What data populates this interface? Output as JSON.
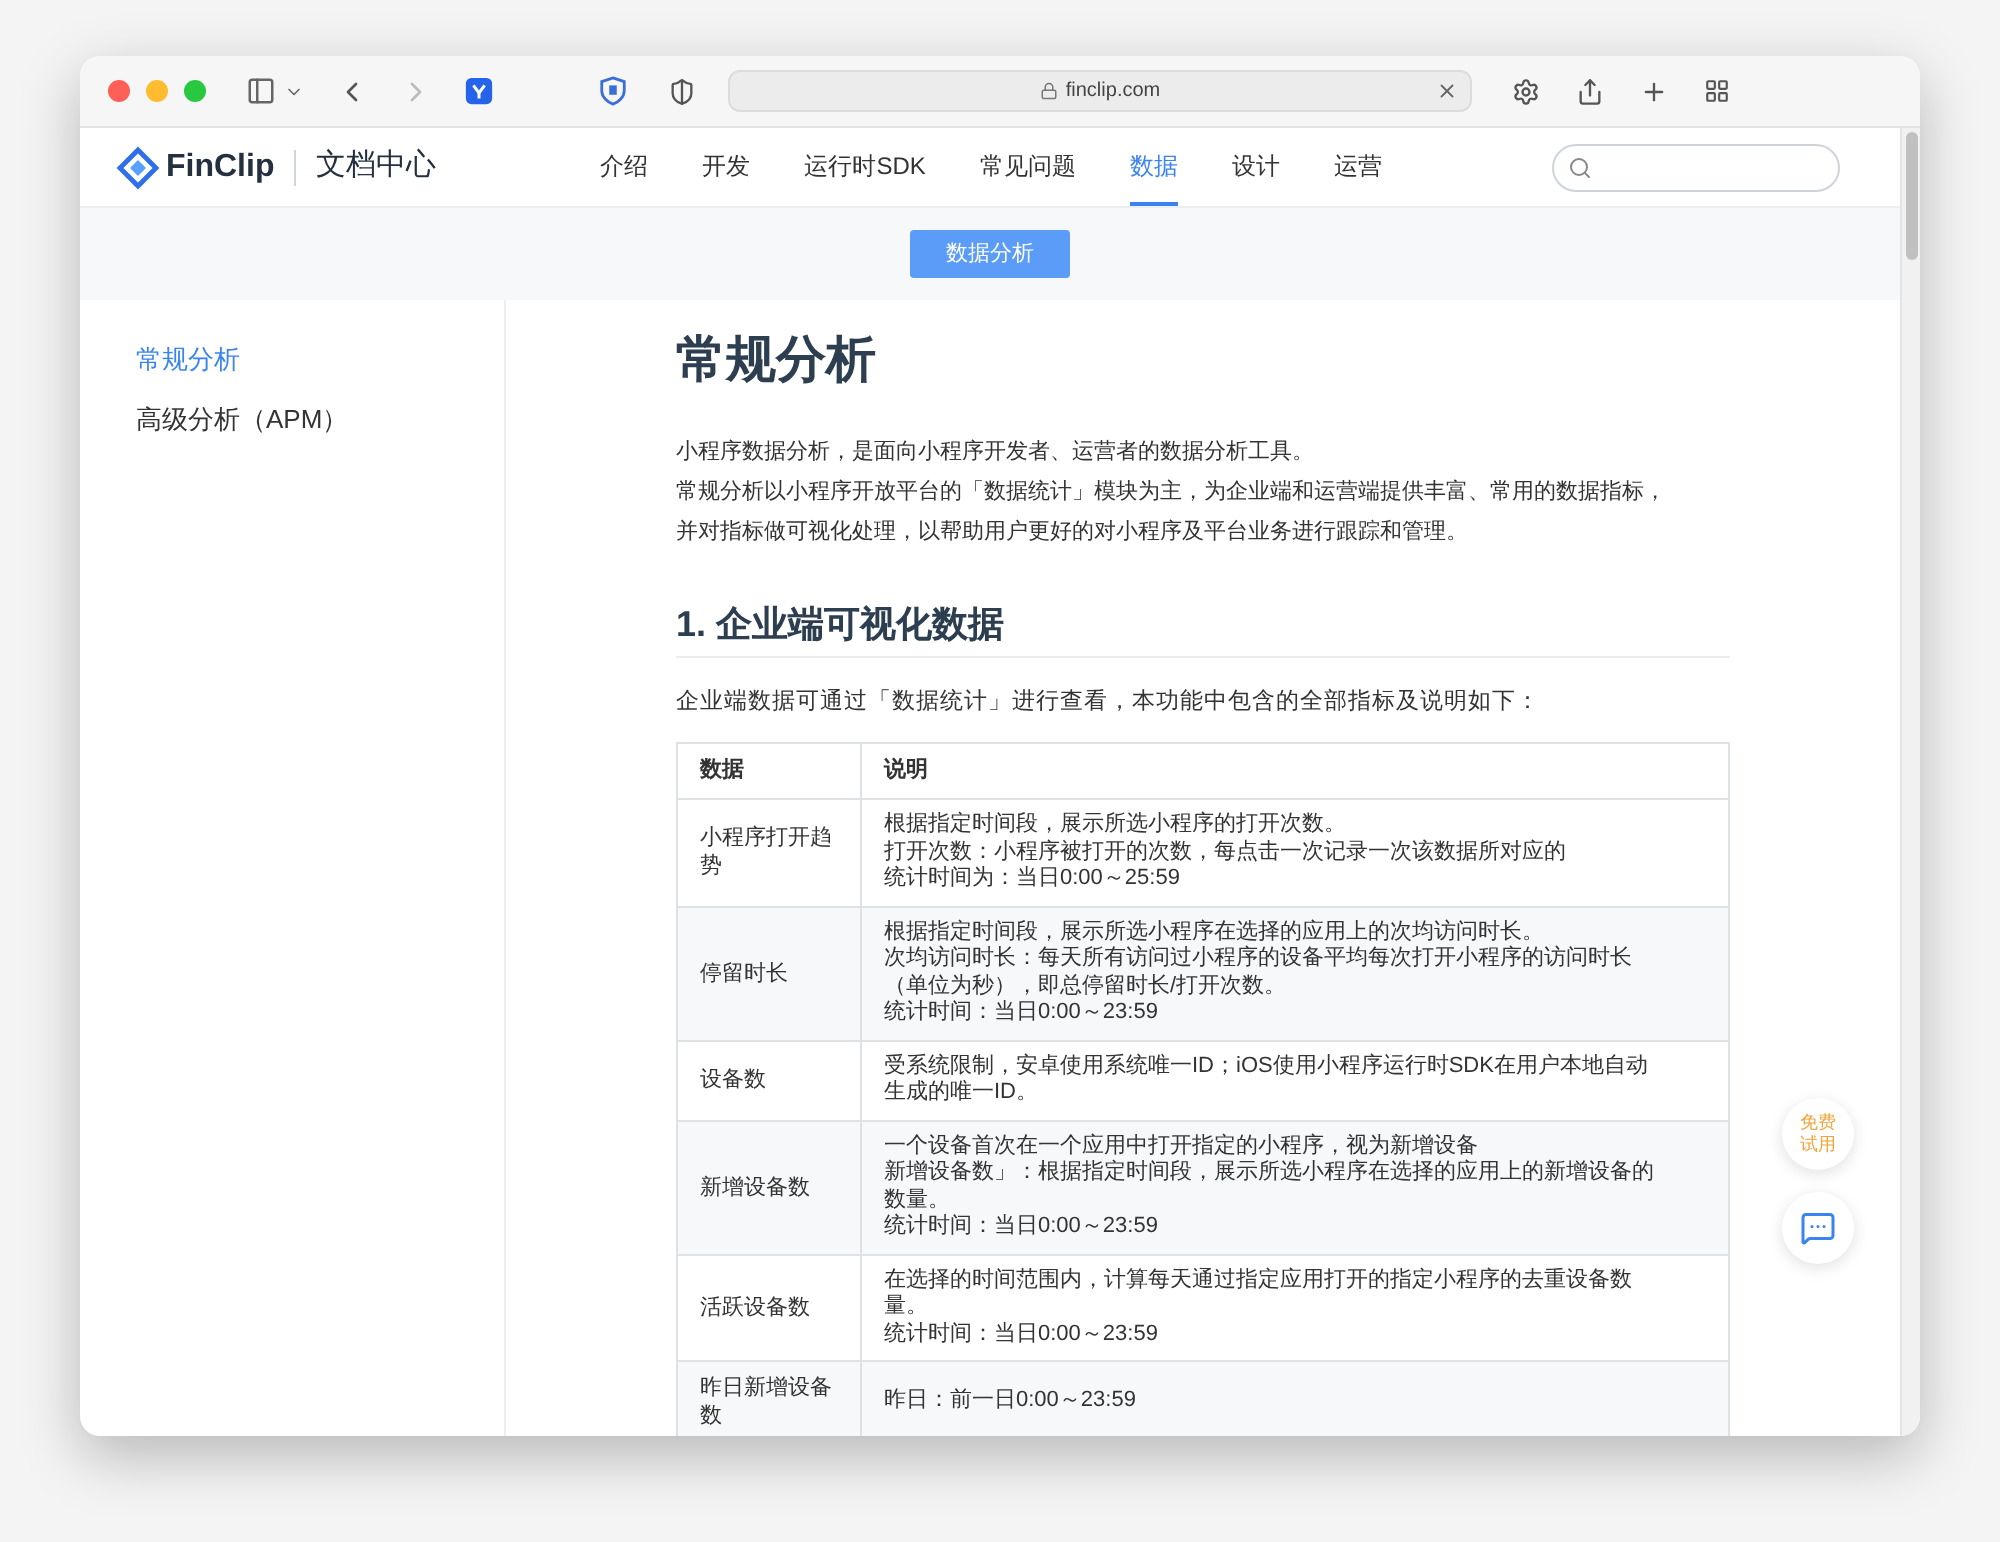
{
  "browser": {
    "url": "finclip.com"
  },
  "header": {
    "logo_text": "FinClip",
    "site_title": "文档中心",
    "nav": [
      {
        "label": "介绍",
        "selected": false
      },
      {
        "label": "开发",
        "selected": false
      },
      {
        "label": "运行时SDK",
        "selected": false
      },
      {
        "label": "常见问题",
        "selected": false
      },
      {
        "label": "数据",
        "selected": true
      },
      {
        "label": "设计",
        "selected": false
      },
      {
        "label": "运营",
        "selected": false
      }
    ]
  },
  "subnav": {
    "button": "数据分析"
  },
  "sidebar": {
    "items": [
      {
        "label": "常规分析",
        "selected": true
      },
      {
        "label": "高级分析（APM）",
        "selected": false
      }
    ]
  },
  "article": {
    "title": "常规分析",
    "intro": [
      "小程序数据分析，是面向小程序开发者、运营者的数据分析工具。",
      "常规分析以小程序开放平台的「数据统计」模块为主，为企业端和运营端提供丰富、常用的数据指标，",
      "并对指标做可视化处理，以帮助用户更好的对小程序及平台业务进行跟踪和管理。"
    ],
    "section_heading": "1. 企业端可视化数据",
    "section_intro": "企业端数据可通过「数据统计」进行查看，本功能中包含的全部指标及说明如下：",
    "table": {
      "columns": [
        "数据",
        "说明"
      ],
      "rows": [
        {
          "name": "小程序打开趋势",
          "lines": [
            "根据指定时间段，展示所选小程序的打开次数。",
            "打开次数：小程序被打开的次数，每点击一次记录一次该数据所对应的",
            "统计时间为：当日0:00～25:59"
          ]
        },
        {
          "name": "停留时长",
          "lines": [
            "根据指定时间段，展示所选小程序在选择的应用上的次均访问时长。",
            "次均访问时长：每天所有访问过小程序的设备平均每次打开小程序的访问时长",
            "（单位为秒），即总停留时长/打开次数。",
            "统计时间：当日0:00～23:59"
          ]
        },
        {
          "name": "设备数",
          "lines": [
            "受系统限制，安卓使用系统唯一ID；iOS使用小程序运行时SDK在用户本地自动",
            "生成的唯一ID。"
          ]
        },
        {
          "name": "新增设备数",
          "lines": [
            "一个设备首次在一个应用中打开指定的小程序，视为新增设备",
            "新增设备数」：根据指定时间段，展示所选小程序在选择的应用上的新增设备的",
            "数量。",
            "统计时间：当日0:00～23:59"
          ]
        },
        {
          "name": "活跃设备数",
          "lines": [
            "在选择的时间范围内，计算每天通过指定应用打开的指定小程序的去重设备数",
            "量。",
            "统计时间：当日0:00～23:59"
          ]
        },
        {
          "name": "昨日新增设备数",
          "lines": [
            "昨日：前一日0:00～23:59"
          ]
        }
      ]
    }
  },
  "floating": {
    "trial": "免费试用"
  }
}
